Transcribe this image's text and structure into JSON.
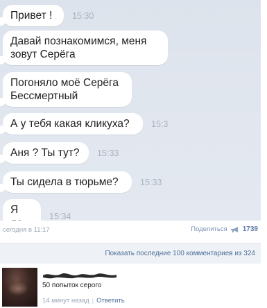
{
  "chat": {
    "messages": [
      {
        "text": "Привет !",
        "time": "15:30"
      },
      {
        "text": "Давай познакомимся, меня зовут Серёга",
        "time": ""
      },
      {
        "text": "Погоняло моё Серёга Бессмертный",
        "time": ""
      },
      {
        "text": "А у тебя какая кликуха?",
        "time": "15:3"
      },
      {
        "text": "Аня ? Ты тут?",
        "time": "15:33"
      },
      {
        "text": "Ты сидела в тюрьме?",
        "time": "15:33"
      },
      {
        "text": "Я да",
        "time": "15:34"
      }
    ]
  },
  "post": {
    "date": "сегодня в 11:17",
    "share_label": "Поделиться",
    "share_count": "1739"
  },
  "comments": {
    "show_label": "Показать последние 100 комментариев из 324"
  },
  "comment": {
    "text": "50 попыток серого",
    "time": "14 минут назад",
    "separator": "|",
    "reply_label": "Ответить"
  }
}
